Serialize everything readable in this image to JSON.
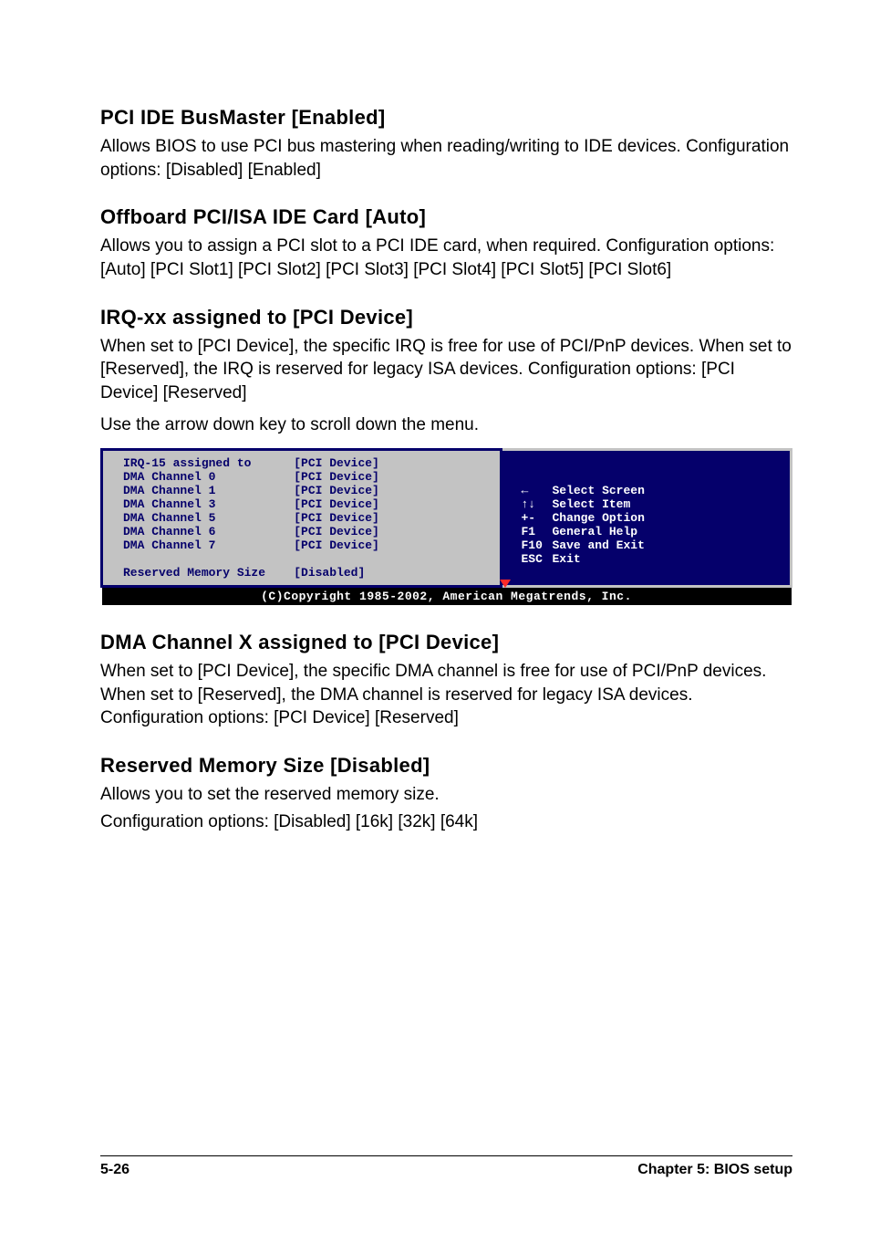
{
  "s1": {
    "heading": "PCI IDE BusMaster [Enabled]",
    "p1": "Allows BIOS to use PCI bus mastering when reading/writing to IDE devices. Configuration options: [Disabled] [Enabled]"
  },
  "s2": {
    "heading": "Offboard PCI/ISA IDE Card [Auto]",
    "p1": "Allows you to assign a PCI slot to a PCI IDE card, when required. Configuration options: [Auto] [PCI Slot1] [PCI Slot2] [PCI Slot3] [PCI Slot4] [PCI Slot5] [PCI Slot6]"
  },
  "s3": {
    "heading": "IRQ-xx assigned to [PCI Device]",
    "p1": "When set to [PCI Device], the specific IRQ is free for use of PCI/PnP devices. When set to [Reserved], the IRQ is reserved for legacy ISA devices. Configuration options: [PCI Device] [Reserved]",
    "p2": "Use the arrow down key to scroll down the menu."
  },
  "bios": {
    "rows": [
      {
        "label": "IRQ-15 assigned to",
        "value": "[PCI Device]"
      },
      {
        "label": "DMA Channel 0",
        "value": "[PCI Device]"
      },
      {
        "label": "DMA Channel 1",
        "value": "[PCI Device]"
      },
      {
        "label": "DMA Channel 3",
        "value": "[PCI Device]"
      },
      {
        "label": "DMA Channel 5",
        "value": "[PCI Device]"
      },
      {
        "label": "DMA Channel 6",
        "value": "[PCI Device]"
      },
      {
        "label": "DMA Channel 7",
        "value": "[PCI Device]"
      },
      {
        "label": "",
        "value": ""
      },
      {
        "label": "Reserved Memory Size",
        "value": "[Disabled]"
      }
    ],
    "help": [
      {
        "key": "←",
        "text": "Select Screen"
      },
      {
        "key": "↑↓",
        "text": "Select Item"
      },
      {
        "key": "+-",
        "text": "Change Option"
      },
      {
        "key": "F1",
        "text": "General Help"
      },
      {
        "key": "F10",
        "text": "Save and Exit"
      },
      {
        "key": "ESC",
        "text": "Exit"
      }
    ],
    "copyright": "(C)Copyright 1985-2002, American Megatrends, Inc."
  },
  "s4": {
    "heading": "DMA Channel X assigned to [PCI Device]",
    "p1": "When set to [PCI Device], the specific DMA channel is free for use of PCI/PnP devices. When set to [Reserved], the DMA channel is reserved for legacy ISA devices. Configuration options: [PCI Device] [Reserved]"
  },
  "s5": {
    "heading": "Reserved Memory Size [Disabled]",
    "p1": "Allows you to set the reserved memory size.",
    "p2": "Configuration options: [Disabled] [16k] [32k] [64k]"
  },
  "footer": {
    "left": "5-26",
    "right": "Chapter 5: BIOS setup"
  }
}
